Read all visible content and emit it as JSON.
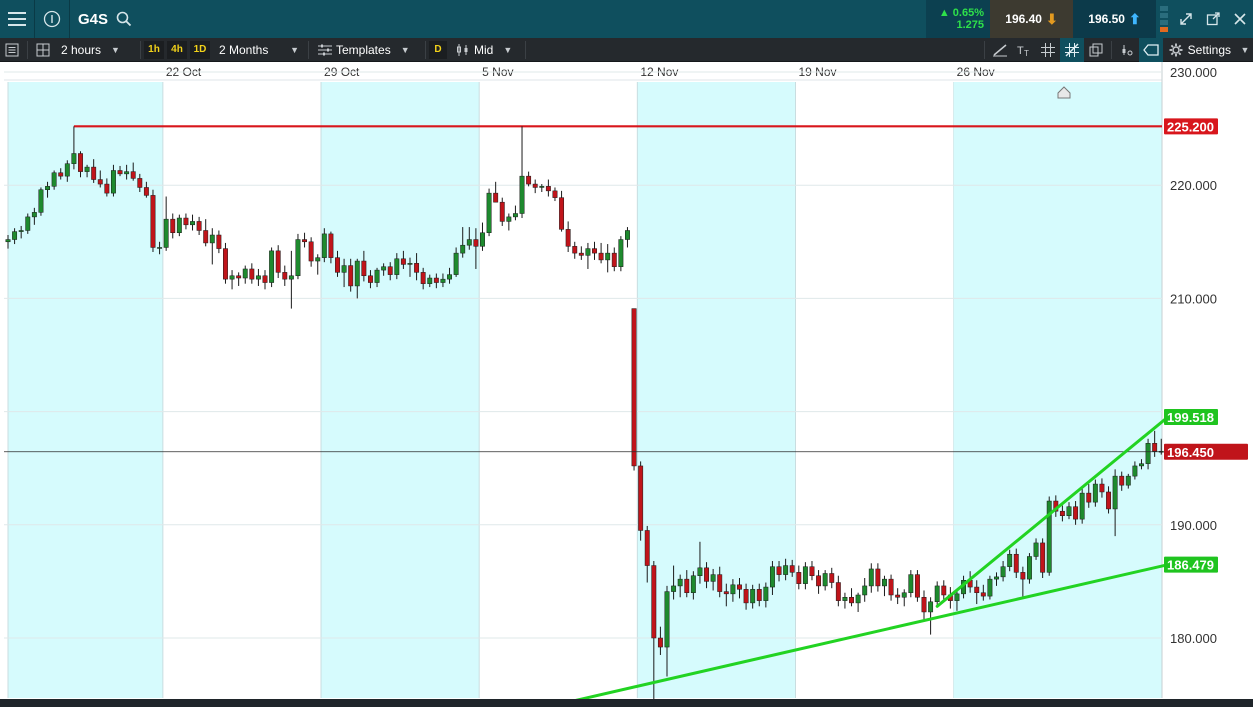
{
  "header": {
    "symbol": "G4S",
    "change_pct": "▲ 0.65%",
    "change_abs": "1.275",
    "sell_price": "196.40",
    "buy_price": "196.50"
  },
  "toolbar": {
    "interval": "2 hours",
    "quick_1": "1h",
    "quick_2": "4h",
    "quick_3": "1D",
    "range": "2 Months",
    "templates": "Templates",
    "d_badge": "D",
    "price_type": "Mid",
    "settings": "Settings"
  },
  "colors": {
    "up": "#1e8a2e",
    "down": "#c0141a",
    "band": "#d6fbfd",
    "resistance": "#d8161c",
    "trend": "#22d322",
    "current_label": "#c0141a"
  },
  "chart_data": {
    "type": "candlestick",
    "x_labels": [
      "22 Oct",
      "29 Oct",
      "5 Nov",
      "12 Nov",
      "19 Nov",
      "26 Nov"
    ],
    "y_ticks": [
      "230.000",
      "220.000",
      "210.000",
      "190.000",
      "180.000"
    ],
    "ylim": [
      169.5,
      231
    ],
    "resistance_level": "225.200",
    "trend_lines": [
      {
        "from_index": 84,
        "from_price": 174.2,
        "to_index": 176,
        "to_price": 186.479,
        "label": "186.479"
      },
      {
        "from_index": 141,
        "from_price": 182.8,
        "to_index": 176,
        "to_price": 199.518,
        "label": "199.518"
      }
    ],
    "current_price": "196.450",
    "candles_ohlc": [
      [
        215.0,
        215.6,
        214.4,
        215.2
      ],
      [
        215.2,
        216.2,
        214.8,
        215.9
      ],
      [
        215.9,
        216.4,
        215.3,
        216.0
      ],
      [
        216.0,
        217.5,
        215.7,
        217.2
      ],
      [
        217.2,
        218.0,
        216.5,
        217.6
      ],
      [
        217.6,
        219.8,
        217.3,
        219.6
      ],
      [
        219.6,
        220.3,
        218.9,
        219.9
      ],
      [
        219.9,
        221.3,
        219.6,
        221.1
      ],
      [
        221.1,
        221.5,
        220.5,
        220.8
      ],
      [
        220.8,
        222.2,
        220.3,
        221.9
      ],
      [
        221.9,
        225.2,
        221.4,
        222.8
      ],
      [
        222.8,
        223.0,
        220.7,
        221.2
      ],
      [
        221.2,
        221.8,
        220.7,
        221.6
      ],
      [
        221.6,
        222.3,
        220.2,
        220.5
      ],
      [
        220.5,
        221.3,
        219.8,
        220.1
      ],
      [
        220.1,
        220.6,
        219.0,
        219.3
      ],
      [
        219.3,
        221.8,
        219.0,
        221.3
      ],
      [
        221.3,
        221.7,
        220.8,
        221.0
      ],
      [
        221.0,
        221.8,
        220.5,
        221.2
      ],
      [
        221.2,
        222.0,
        220.4,
        220.6
      ],
      [
        220.6,
        221.0,
        219.4,
        219.8
      ],
      [
        219.8,
        220.3,
        218.9,
        219.1
      ],
      [
        219.1,
        219.6,
        214.1,
        214.5
      ],
      [
        214.5,
        215.0,
        213.9,
        214.5
      ],
      [
        214.5,
        219.0,
        214.2,
        217.0
      ],
      [
        217.0,
        217.5,
        215.3,
        215.8
      ],
      [
        215.8,
        217.4,
        215.5,
        217.1
      ],
      [
        217.1,
        217.5,
        216.1,
        216.5
      ],
      [
        216.5,
        217.4,
        216.0,
        216.8
      ],
      [
        216.8,
        217.2,
        215.6,
        216.0
      ],
      [
        216.0,
        217.0,
        214.6,
        214.9
      ],
      [
        214.9,
        216.2,
        213.0,
        215.6
      ],
      [
        215.6,
        216.0,
        214.0,
        214.4
      ],
      [
        214.4,
        214.9,
        211.3,
        211.7
      ],
      [
        211.7,
        212.5,
        210.8,
        212.0
      ],
      [
        212.0,
        212.3,
        211.1,
        211.8
      ],
      [
        211.8,
        212.9,
        211.3,
        212.6
      ],
      [
        212.6,
        213.1,
        211.3,
        211.7
      ],
      [
        211.7,
        212.6,
        211.1,
        212.0
      ],
      [
        212.0,
        212.5,
        210.8,
        211.4
      ],
      [
        211.4,
        214.5,
        211.0,
        214.2
      ],
      [
        214.2,
        214.7,
        211.8,
        212.3
      ],
      [
        212.3,
        212.9,
        211.1,
        211.7
      ],
      [
        211.7,
        214.2,
        209.1,
        212.0
      ],
      [
        212.0,
        215.7,
        211.7,
        215.2
      ],
      [
        215.2,
        215.8,
        214.5,
        215.0
      ],
      [
        215.0,
        215.4,
        212.8,
        213.3
      ],
      [
        213.3,
        213.9,
        212.1,
        213.6
      ],
      [
        213.6,
        216.2,
        213.2,
        215.7
      ],
      [
        215.7,
        215.9,
        213.1,
        213.6
      ],
      [
        213.6,
        214.2,
        211.9,
        212.3
      ],
      [
        212.3,
        213.5,
        211.0,
        212.9
      ],
      [
        212.9,
        213.5,
        210.6,
        211.1
      ],
      [
        211.1,
        213.5,
        210.0,
        213.3
      ],
      [
        213.3,
        214.2,
        211.5,
        212.0
      ],
      [
        212.0,
        212.5,
        210.9,
        211.4
      ],
      [
        211.4,
        212.7,
        211.0,
        212.5
      ],
      [
        212.5,
        213.1,
        212.0,
        212.8
      ],
      [
        212.8,
        213.2,
        211.6,
        212.1
      ],
      [
        212.1,
        214.0,
        211.7,
        213.5
      ],
      [
        213.5,
        214.2,
        212.6,
        213.0
      ],
      [
        213.0,
        213.6,
        211.9,
        213.1
      ],
      [
        213.1,
        214.0,
        211.6,
        212.3
      ],
      [
        212.3,
        212.7,
        210.8,
        211.3
      ],
      [
        211.3,
        212.1,
        211.0,
        211.8
      ],
      [
        211.8,
        212.2,
        210.9,
        211.4
      ],
      [
        211.4,
        212.2,
        211.0,
        211.7
      ],
      [
        211.7,
        212.7,
        211.3,
        212.1
      ],
      [
        212.1,
        214.5,
        211.9,
        214.0
      ],
      [
        214.0,
        216.3,
        213.6,
        214.7
      ],
      [
        214.7,
        216.3,
        214.3,
        215.2
      ],
      [
        215.2,
        216.2,
        212.6,
        214.6
      ],
      [
        214.6,
        216.7,
        214.2,
        215.8
      ],
      [
        215.8,
        219.7,
        215.5,
        219.3
      ],
      [
        219.3,
        220.3,
        218.5,
        218.5
      ],
      [
        218.5,
        218.9,
        216.4,
        216.8
      ],
      [
        216.8,
        217.5,
        216.0,
        217.2
      ],
      [
        217.2,
        218.2,
        216.9,
        217.5
      ],
      [
        217.5,
        225.2,
        217.1,
        220.8
      ],
      [
        220.8,
        221.2,
        219.9,
        220.1
      ],
      [
        220.1,
        220.5,
        219.3,
        219.8
      ],
      [
        219.8,
        220.1,
        219.4,
        219.9
      ],
      [
        219.9,
        220.5,
        219.0,
        219.5
      ],
      [
        219.5,
        219.8,
        218.6,
        218.9
      ],
      [
        218.9,
        219.5,
        215.9,
        216.1
      ],
      [
        216.1,
        216.8,
        214.1,
        214.6
      ],
      [
        214.6,
        215.0,
        213.5,
        214.0
      ],
      [
        214.0,
        214.6,
        213.4,
        213.8
      ],
      [
        213.8,
        214.9,
        212.6,
        214.4
      ],
      [
        214.4,
        215.0,
        213.4,
        214.0
      ],
      [
        214.0,
        214.9,
        213.1,
        213.4
      ],
      [
        213.4,
        214.8,
        212.3,
        214.0
      ],
      [
        214.0,
        214.5,
        212.4,
        212.8
      ],
      [
        212.8,
        215.5,
        212.4,
        215.2
      ],
      [
        215.2,
        216.3,
        214.5,
        216.0
      ],
      [
        209.1,
        209.1,
        194.8,
        195.2
      ],
      [
        195.2,
        195.6,
        188.6,
        189.5
      ],
      [
        189.5,
        189.9,
        184.9,
        186.4
      ],
      [
        186.4,
        186.8,
        174.1,
        180.0
      ],
      [
        180.0,
        181.0,
        178.5,
        179.2
      ],
      [
        179.2,
        184.6,
        176.6,
        184.1
      ],
      [
        184.1,
        186.4,
        183.4,
        184.6
      ],
      [
        184.6,
        185.6,
        183.6,
        185.2
      ],
      [
        185.2,
        186.0,
        183.6,
        184.0
      ],
      [
        184.0,
        185.9,
        183.4,
        185.5
      ],
      [
        185.5,
        188.5,
        184.8,
        186.2
      ],
      [
        186.2,
        186.7,
        184.4,
        185.0
      ],
      [
        185.0,
        186.1,
        184.2,
        185.6
      ],
      [
        185.6,
        186.3,
        183.6,
        184.1
      ],
      [
        184.1,
        184.8,
        182.8,
        183.9
      ],
      [
        183.9,
        185.2,
        183.2,
        184.7
      ],
      [
        184.7,
        185.3,
        183.5,
        184.3
      ],
      [
        184.3,
        184.8,
        182.5,
        183.1
      ],
      [
        183.1,
        184.7,
        182.6,
        184.3
      ],
      [
        184.3,
        184.8,
        182.8,
        183.3
      ],
      [
        183.3,
        184.9,
        182.7,
        184.5
      ],
      [
        184.5,
        186.8,
        183.8,
        186.3
      ],
      [
        186.3,
        186.8,
        185.0,
        185.6
      ],
      [
        185.6,
        187.0,
        185.1,
        186.4
      ],
      [
        186.4,
        186.9,
        185.4,
        185.8
      ],
      [
        185.8,
        186.4,
        184.3,
        184.8
      ],
      [
        184.8,
        186.7,
        184.3,
        186.3
      ],
      [
        186.3,
        186.8,
        185.1,
        185.5
      ],
      [
        185.5,
        186.0,
        183.9,
        184.6
      ],
      [
        184.6,
        186.0,
        184.2,
        185.7
      ],
      [
        185.7,
        186.2,
        184.4,
        184.9
      ],
      [
        184.9,
        185.5,
        182.8,
        183.3
      ],
      [
        183.3,
        184.0,
        182.6,
        183.6
      ],
      [
        183.6,
        184.4,
        182.8,
        183.1
      ],
      [
        183.1,
        184.0,
        182.3,
        183.8
      ],
      [
        183.8,
        185.3,
        183.2,
        184.6
      ],
      [
        184.6,
        186.6,
        184.0,
        186.1
      ],
      [
        186.1,
        186.6,
        184.1,
        184.6
      ],
      [
        184.6,
        185.5,
        183.7,
        185.2
      ],
      [
        185.2,
        185.6,
        183.3,
        183.8
      ],
      [
        183.8,
        184.4,
        183.0,
        183.6
      ],
      [
        183.6,
        184.3,
        182.8,
        184.0
      ],
      [
        184.0,
        186.0,
        183.6,
        185.6
      ],
      [
        185.6,
        186.0,
        183.2,
        183.6
      ],
      [
        183.6,
        184.2,
        181.6,
        182.3
      ],
      [
        182.3,
        183.6,
        180.3,
        183.2
      ],
      [
        183.2,
        185.0,
        182.8,
        184.6
      ],
      [
        184.6,
        185.1,
        183.3,
        183.8
      ],
      [
        183.8,
        184.5,
        182.6,
        183.3
      ],
      [
        183.3,
        184.3,
        182.4,
        183.9
      ],
      [
        183.9,
        185.5,
        183.5,
        185.1
      ],
      [
        185.1,
        185.9,
        184.0,
        184.5
      ],
      [
        184.5,
        185.1,
        183.0,
        184.0
      ],
      [
        184.0,
        184.7,
        183.3,
        183.7
      ],
      [
        183.7,
        185.5,
        183.4,
        185.2
      ],
      [
        185.2,
        185.8,
        184.6,
        185.4
      ],
      [
        185.4,
        186.8,
        185.0,
        186.3
      ],
      [
        186.3,
        187.8,
        185.9,
        187.4
      ],
      [
        187.4,
        187.9,
        185.3,
        185.8
      ],
      [
        185.8,
        186.3,
        183.5,
        185.2
      ],
      [
        185.2,
        187.5,
        184.8,
        187.2
      ],
      [
        187.2,
        188.8,
        186.9,
        188.4
      ],
      [
        188.4,
        188.8,
        185.3,
        185.8
      ],
      [
        185.8,
        192.5,
        185.5,
        192.1
      ],
      [
        192.1,
        192.6,
        190.7,
        191.2
      ],
      [
        191.2,
        191.7,
        190.3,
        190.8
      ],
      [
        190.8,
        192.0,
        190.5,
        191.6
      ],
      [
        191.6,
        192.1,
        190.0,
        190.5
      ],
      [
        190.5,
        193.2,
        190.1,
        192.8
      ],
      [
        192.8,
        193.6,
        191.5,
        192.0
      ],
      [
        192.0,
        194.0,
        191.6,
        193.6
      ],
      [
        193.6,
        194.1,
        192.4,
        192.9
      ],
      [
        192.9,
        193.4,
        191.0,
        191.4
      ],
      [
        191.4,
        194.9,
        189.0,
        194.3
      ],
      [
        194.3,
        194.7,
        193.0,
        193.5
      ],
      [
        193.5,
        194.5,
        193.2,
        194.3
      ],
      [
        194.3,
        195.6,
        194.0,
        195.2
      ],
      [
        195.2,
        195.8,
        194.9,
        195.4
      ],
      [
        195.4,
        197.6,
        194.9,
        197.2
      ],
      [
        197.2,
        198.3,
        196.0,
        196.5
      ],
      [
        196.5,
        197.6,
        196.2,
        196.5
      ]
    ]
  }
}
